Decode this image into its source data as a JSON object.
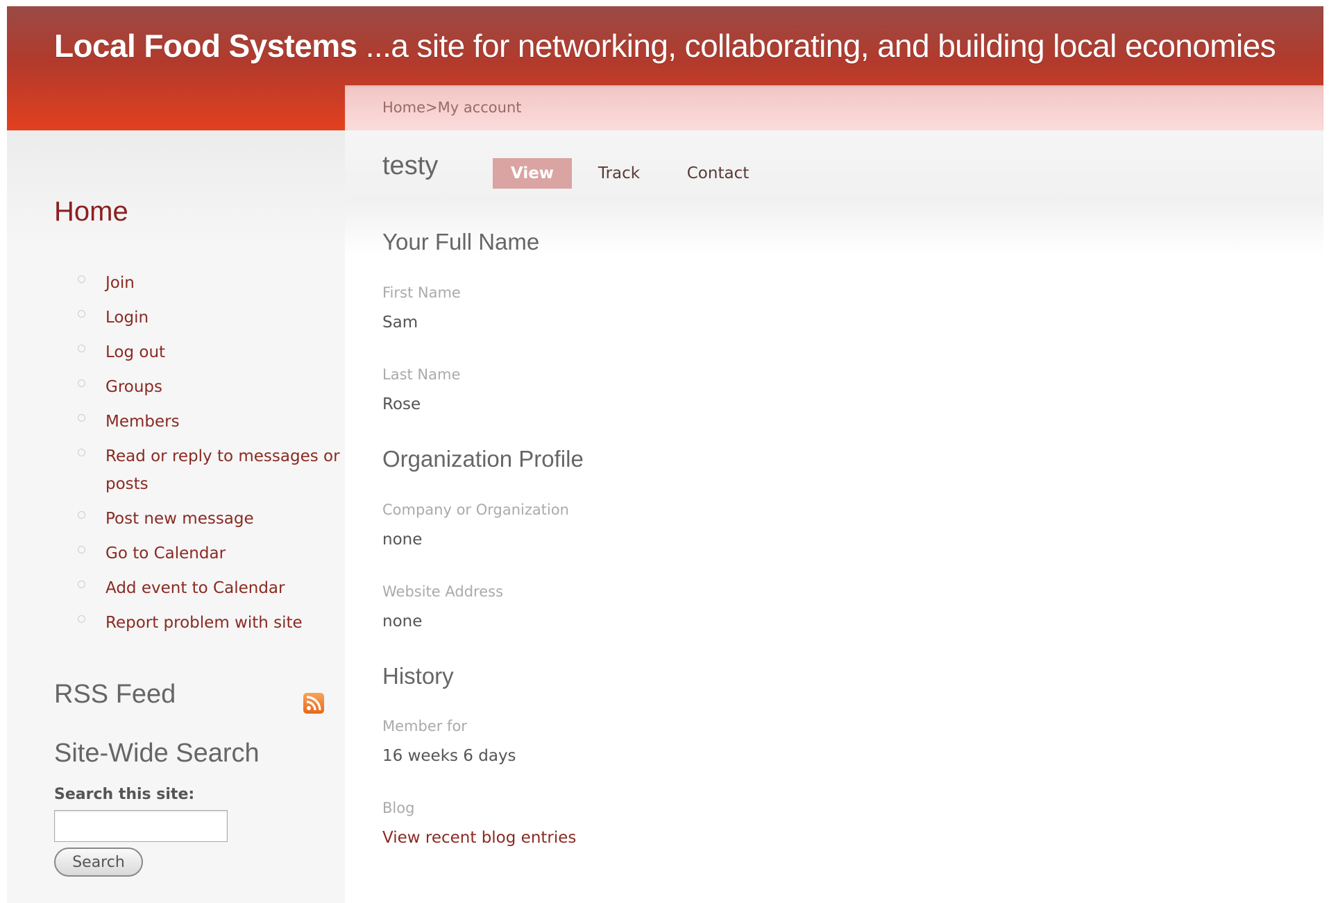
{
  "header": {
    "site_name": "Local Food Systems",
    "slogan": " ...a site for networking, collaborating, and building local economies"
  },
  "breadcrumb": "Home>My account",
  "sidebar": {
    "home_title": "Home",
    "menu_items": [
      {
        "label": "Join"
      },
      {
        "label": "Login"
      },
      {
        "label": "Log out"
      },
      {
        "label": "Groups"
      },
      {
        "label": "Members"
      },
      {
        "label": "Read or reply to messages or posts"
      },
      {
        "label": "Post new message"
      },
      {
        "label": "Go to Calendar"
      },
      {
        "label": "Add event to Calendar"
      },
      {
        "label": "Report problem with site"
      }
    ],
    "rss_title": "RSS Feed",
    "rss_icon": "rss-feed-icon",
    "search_title": "Site-Wide Search",
    "search_label": "Search this site:",
    "search_value": "",
    "search_button": "Search"
  },
  "main": {
    "username": "testy",
    "tabs": [
      {
        "label": "View",
        "active": true
      },
      {
        "label": "Track",
        "active": false
      },
      {
        "label": "Contact",
        "active": false
      }
    ],
    "sections": {
      "full_name": {
        "title": "Your Full Name",
        "first_name_label": "First Name",
        "first_name_value": "Sam",
        "last_name_label": "Last Name",
        "last_name_value": "Rose"
      },
      "organization": {
        "title": "Organization Profile",
        "company_label": "Company or Organization",
        "company_value": "none",
        "website_label": "Website Address",
        "website_value": "none"
      },
      "history": {
        "title": "History",
        "member_for_label": "Member for",
        "member_for_value": "16 weeks 6 days",
        "blog_label": "Blog",
        "blog_link": "View recent blog entries"
      }
    }
  },
  "colors": {
    "header_top": "#9a4a45",
    "header_bottom": "#e2401f",
    "breadcrumb_bg": "#fbdcdb",
    "link": "#8a2a22",
    "active_tab": "#d9a4a2"
  }
}
